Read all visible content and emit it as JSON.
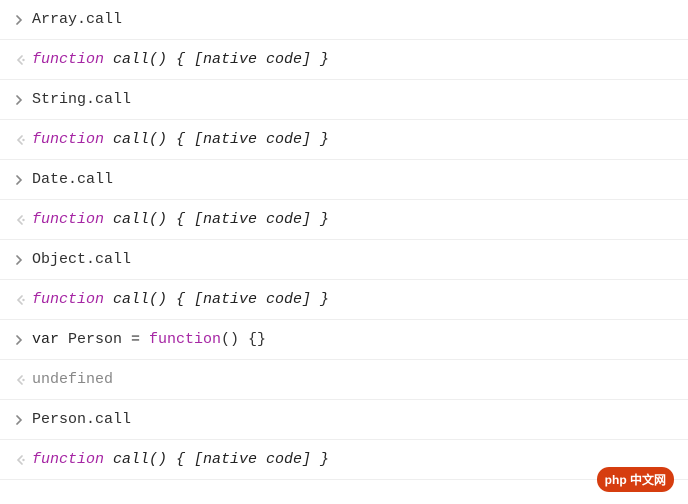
{
  "rows": [
    {
      "type": "input",
      "text": "Array.call"
    },
    {
      "type": "output",
      "kind": "fn"
    },
    {
      "type": "input",
      "text": "String.call"
    },
    {
      "type": "output",
      "kind": "fn"
    },
    {
      "type": "input",
      "text": "Date.call"
    },
    {
      "type": "output",
      "kind": "fn"
    },
    {
      "type": "input",
      "text": "Object.call"
    },
    {
      "type": "output",
      "kind": "fn"
    },
    {
      "type": "input",
      "kind": "vardecl"
    },
    {
      "type": "output",
      "kind": "undef"
    },
    {
      "type": "input",
      "text": "Person.call"
    },
    {
      "type": "output",
      "kind": "fn"
    }
  ],
  "tokens": {
    "function_kw": "function",
    "call_sig": " call() { [native code] }",
    "var_kw": "var",
    "person_decl_mid": " Person = ",
    "fn_kw2": "function",
    "anon_body": "() {}",
    "undefined": "undefined"
  },
  "watermark": "php 中文网"
}
